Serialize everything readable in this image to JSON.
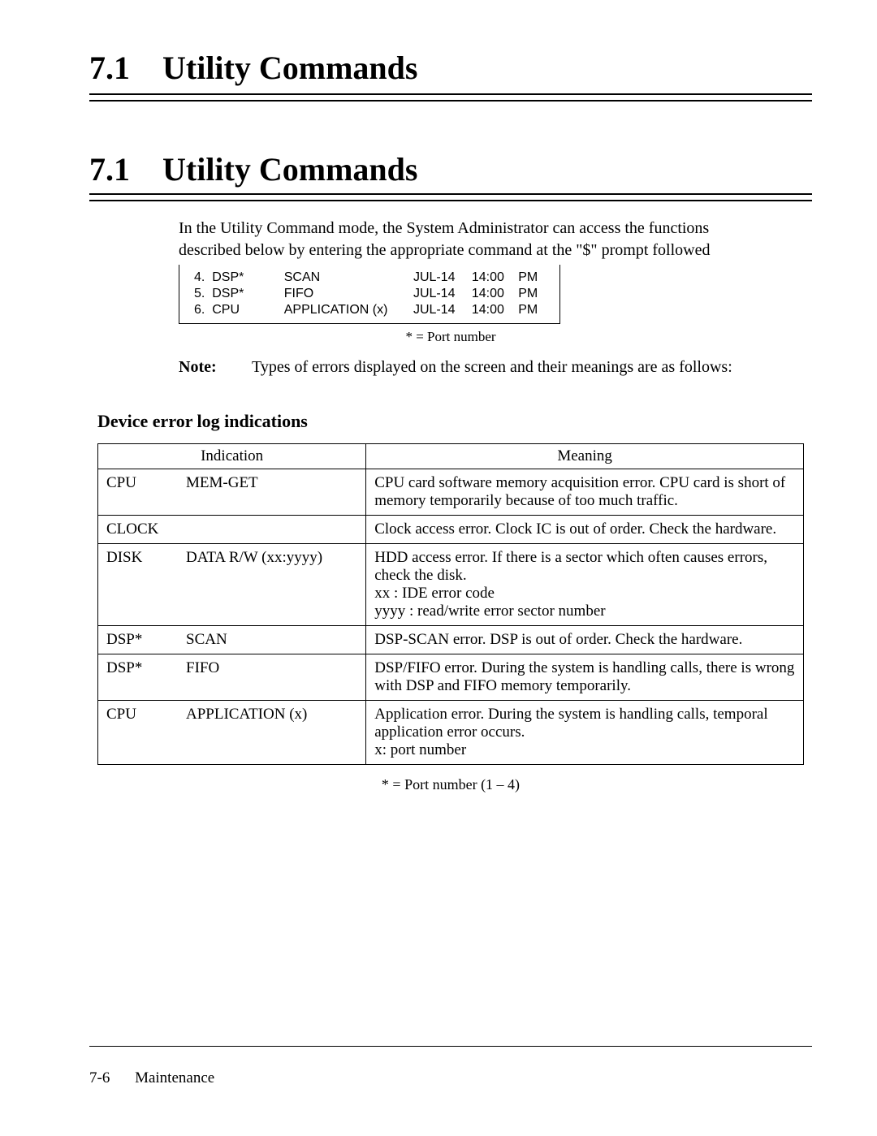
{
  "heading": {
    "number": "7.1",
    "title": "Utility Commands"
  },
  "intro": {
    "line1": "In the Utility Command mode, the System Administrator can access the functions",
    "line2": "described below by entering the appropriate command at the \"$\" prompt followed"
  },
  "list": {
    "rows": [
      {
        "n": "4.",
        "dev": "DSP*",
        "ind": "SCAN",
        "date": "JUL-14",
        "time": "14:00",
        "ampm": "PM"
      },
      {
        "n": "5.",
        "dev": "DSP*",
        "ind": "FIFO",
        "date": "JUL-14",
        "time": "14:00",
        "ampm": "PM"
      },
      {
        "n": "6.",
        "dev": "CPU",
        "ind": "APPLICATION (x)",
        "date": "JUL-14",
        "time": "14:00",
        "ampm": "PM"
      }
    ]
  },
  "port_caption1": "* = Port number",
  "note": {
    "label": "Note:",
    "text": "Types of errors displayed on the screen and their meanings are as follows:"
  },
  "errors_heading": "Device error log indications",
  "errors": {
    "headers": {
      "indication": "Indication",
      "meaning": "Meaning"
    },
    "rows": [
      {
        "dev": "CPU",
        "ind": "MEM-GET",
        "meaning": "CPU card software memory acquisition error. CPU card is short of memory temporarily because of too much traffic."
      },
      {
        "dev": "CLOCK",
        "ind": "",
        "meaning": "Clock access error.  Clock IC is out of order. Check the hardware."
      },
      {
        "dev": "DISK",
        "ind": "DATA R/W (xx:yyyy)",
        "meaning": "HDD access error.  If there is a sector which often causes errors, check the disk.\nxx :   IDE error code\nyyyy : read/write error sector number"
      },
      {
        "dev": "DSP*",
        "ind": "SCAN",
        "meaning": "DSP-SCAN error.  DSP is out of order.  Check the hardware."
      },
      {
        "dev": "DSP*",
        "ind": "FIFO",
        "meaning": "DSP/FIFO error.  During the system is handling calls, there is wrong with DSP and FIFO memory temporarily."
      },
      {
        "dev": "CPU",
        "ind": "APPLICATION (x)",
        "meaning": "Application error.  During the system is handling calls, temporal application error occurs.\n  x:  port number"
      }
    ]
  },
  "port_caption2": "*  =  Port  number  (1  –  4)",
  "footer": {
    "page": "7-6",
    "section": "Maintenance"
  }
}
